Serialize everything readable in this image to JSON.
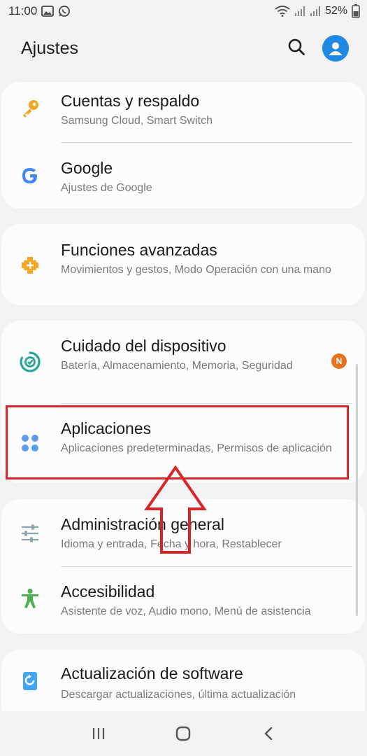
{
  "status_bar": {
    "time": "11:00",
    "battery": "52%",
    "icons_left": [
      "gallery-icon",
      "whatsapp-icon"
    ],
    "icons_right": [
      "wifi-icon",
      "signal-icon",
      "signal-icon"
    ]
  },
  "header": {
    "title": "Ajustes",
    "search_icon": "search-icon",
    "avatar_icon": "account-icon"
  },
  "cards": [
    {
      "items": [
        {
          "title": "Cuentas y respaldo",
          "subtitle": "Samsung Cloud, Smart Switch",
          "icon": "key-icon",
          "icon_color": "#f5a623"
        },
        {
          "title": "Google",
          "subtitle": "Ajustes de Google",
          "icon": "google-icon",
          "icon_color": "#4285f4"
        }
      ]
    },
    {
      "items": [
        {
          "title": "Funciones avanzadas",
          "subtitle": "Movimientos y gestos, Modo Operación con una mano",
          "icon": "puzzle-plus-icon",
          "icon_color": "#f5a623"
        }
      ]
    },
    {
      "items": [
        {
          "title": "Cuidado del dispositivo",
          "subtitle": "Batería, Almacenamiento, Memoria, Seguridad",
          "icon": "device-care-icon",
          "icon_color": "#26a69a",
          "badge": "N"
        },
        {
          "title": "Aplicaciones",
          "subtitle": "Aplicaciones predeterminadas, Permisos de aplicación",
          "icon": "apps-icon",
          "icon_color": "#5c9ded"
        }
      ]
    },
    {
      "items": [
        {
          "title": "Administración general",
          "subtitle": "Idioma y entrada, Fecha y hora, Restablecer",
          "icon": "sliders-icon",
          "icon_color": "#90a4ae"
        },
        {
          "title": "Accesibilidad",
          "subtitle": "Asistente de voz, Audio mono, Menú de asistencia",
          "icon": "accessibility-icon",
          "icon_color": "#4caf50"
        }
      ]
    },
    {
      "items": [
        {
          "title": "Actualización de software",
          "subtitle": "Descargar actualizaciones, última actualización",
          "icon": "software-update-icon",
          "icon_color": "#42a5f5"
        }
      ]
    }
  ],
  "annotation": {
    "highlight_color": "#d9252a"
  },
  "nav_bar": {
    "recents_icon": "recents-icon",
    "home_icon": "home-icon",
    "back_icon": "back-icon"
  }
}
